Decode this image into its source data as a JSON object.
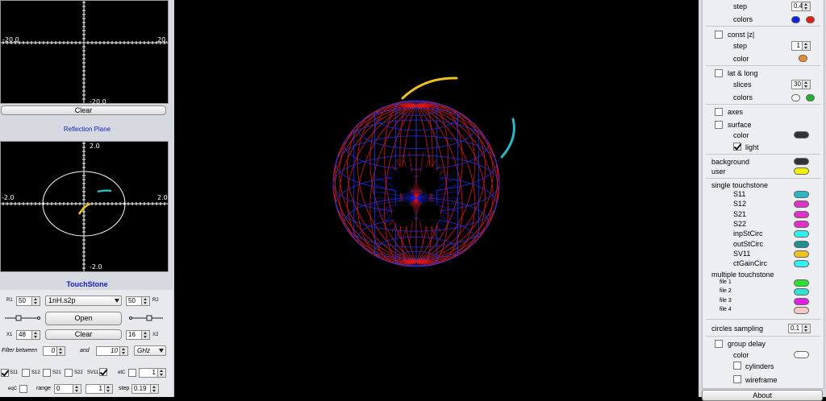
{
  "impedance_plot": {
    "label_left": "-20.0",
    "label_right": "20.",
    "label_bottom": "-20.0"
  },
  "clear_top_label": "Clear",
  "reflection": {
    "title": "Reflection Plane",
    "y_top": "2.0",
    "x_left": "-2.0",
    "x_right": "2.0",
    "y_bottom": "-2.0"
  },
  "touchstone": {
    "title": "TouchStone",
    "r1_label": "R1",
    "r1_value": "50",
    "file": "1nH.s2p",
    "r2_value": "50",
    "r2_label": "R2",
    "open_label": "Open",
    "x1_label": "X1",
    "x1_value": "48",
    "clear_label": "Clear",
    "x2_value": "16",
    "x2_label": "X2",
    "filter_label": "Filter between",
    "filter_min": "0",
    "and_label": "and",
    "filter_max": "10",
    "unit": "GHz",
    "s11": "S11",
    "s12": "S12",
    "s21": "S21",
    "s22": "S22",
    "sv11": "SV11",
    "etc": "etC",
    "etc_value": "1",
    "eqc": "eqC",
    "range_label": "range",
    "range_min": "0",
    "range_max": "1",
    "step_label": "step",
    "step_value": "0.19"
  },
  "settings": {
    "step1_label": "step",
    "step1_value": "0.4",
    "colors1_label": "colors",
    "const_z_label": "const |z|",
    "step2_label": "step",
    "step2_value": "1",
    "color2_label": "color",
    "latlong_label": "lat & long",
    "slices_label": "slices",
    "slices_value": "30",
    "colors3_label": "colors",
    "axes_label": "axes",
    "surface_label": "surface",
    "surface_color_label": "color",
    "light_label": "light",
    "background_label": "background",
    "user_label": "user",
    "single_touchstone_label": "single touchstone",
    "single_items": [
      "S11",
      "S12",
      "S21",
      "S22",
      "inpStCirc",
      "outStCirc",
      "SV11",
      "ctGainCirc"
    ],
    "multiple_touchstone_label": "multiple touchstone",
    "file_items": [
      "file 1",
      "file 2",
      "file 3",
      "file 4"
    ],
    "circles_sampling_label": "circles sampling",
    "circles_sampling_value": "0.1",
    "group_delay_label": "group delay",
    "gd_color_label": "color",
    "cylinders_label": "cylinders",
    "wireframe_label": "wireframe",
    "about_label": "About"
  },
  "colors": {
    "colors1": [
      "#1020e0",
      "#e02010"
    ],
    "color2": "#e88a30",
    "colors3": [
      "#ffffff",
      "#20b030"
    ],
    "surface": "#333333",
    "background": "#333333",
    "user": "#f0f000",
    "single": [
      "#2ab6c4",
      "#e030c8",
      "#e030c8",
      "#e030c8",
      "#30f0f0",
      "#209090",
      "#f0c020",
      "#30f0f0"
    ],
    "files": [
      "#30e030",
      "#30e0d0",
      "#e020e0",
      "#f8c8c8"
    ],
    "gd": "#ffffff"
  }
}
